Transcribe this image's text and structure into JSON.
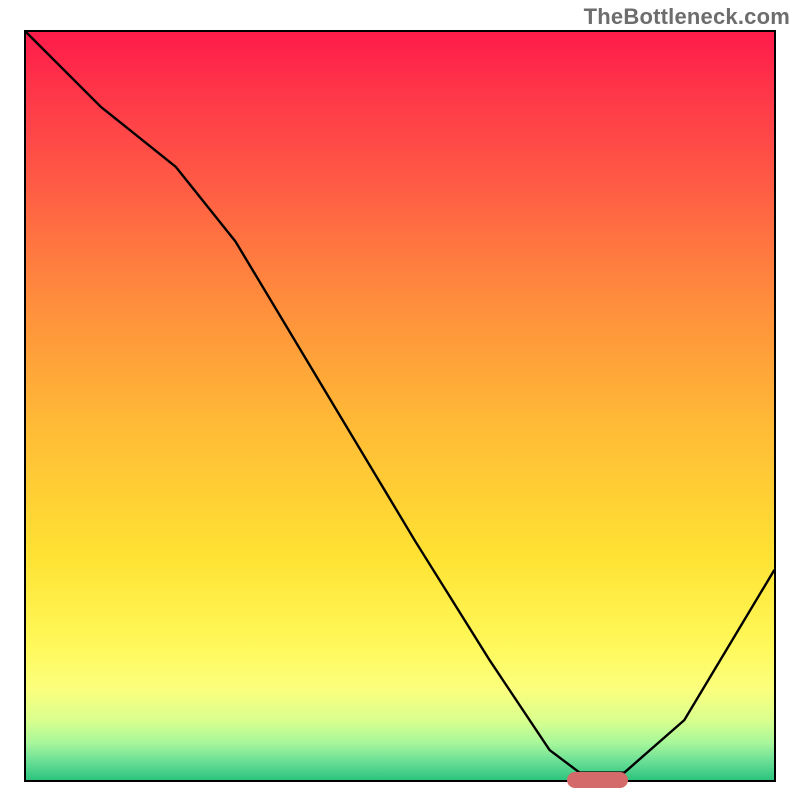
{
  "watermark": "TheBottleneck.com",
  "chart_data": {
    "type": "line",
    "title": "",
    "xlabel": "",
    "ylabel": "",
    "xlim": [
      0,
      100
    ],
    "ylim": [
      0,
      100
    ],
    "grid": false,
    "legend": false,
    "background_gradient": {
      "direction": "vertical",
      "stops": [
        {
          "pos": 0.0,
          "color": "#ff1b4a"
        },
        {
          "pos": 0.35,
          "color": "#ff8a3d"
        },
        {
          "pos": 0.7,
          "color": "#ffe233"
        },
        {
          "pos": 0.92,
          "color": "#d9ff8e"
        },
        {
          "pos": 1.0,
          "color": "#2bc47e"
        }
      ]
    },
    "x": [
      0,
      10,
      20,
      28,
      40,
      52,
      62,
      70,
      74,
      80,
      88,
      100
    ],
    "values": [
      100,
      90,
      82,
      72,
      52,
      32,
      16,
      4,
      1,
      1,
      8,
      28
    ],
    "marker": {
      "x_start": 72,
      "x_end": 80,
      "y": 0.5
    }
  }
}
